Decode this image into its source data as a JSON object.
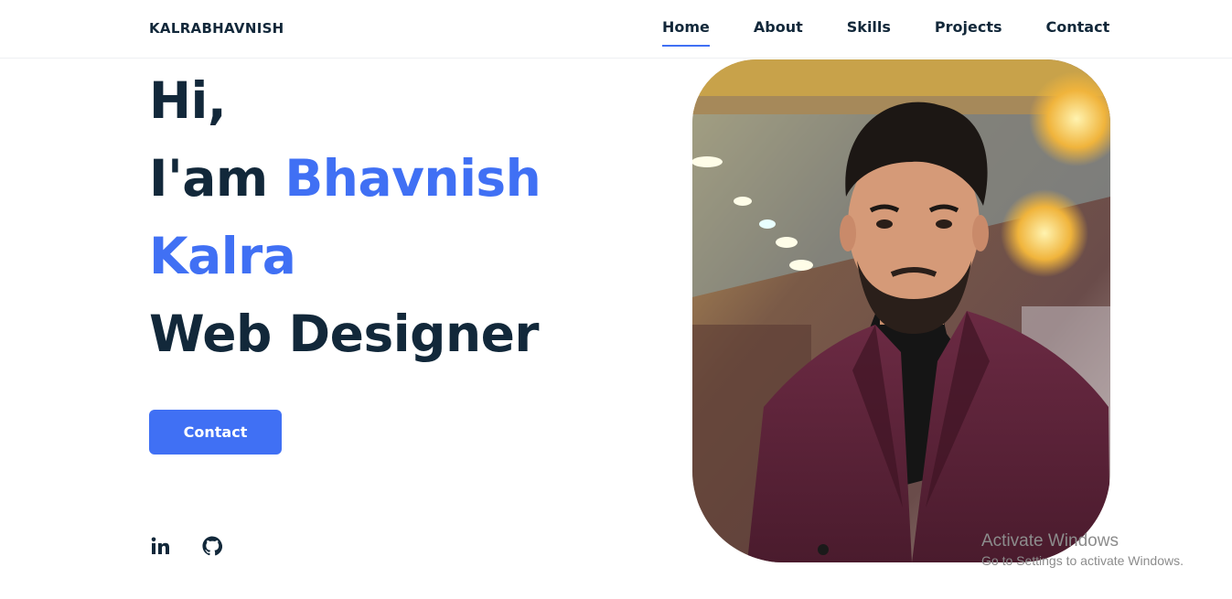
{
  "header": {
    "logo": "KALRABHAVNISH",
    "nav": [
      {
        "label": "Home",
        "active": true
      },
      {
        "label": "About"
      },
      {
        "label": "Skills"
      },
      {
        "label": "Projects"
      },
      {
        "label": "Contact"
      }
    ]
  },
  "hero": {
    "greeting": "Hi,",
    "intro_prefix": "I'am ",
    "first_name": "Bhavnish",
    "last_name": "Kalra",
    "role": "Web Designer",
    "cta_label": "Contact"
  },
  "social": [
    {
      "name": "linkedin",
      "icon": "linkedin-icon"
    },
    {
      "name": "github",
      "icon": "github-icon"
    }
  ],
  "colors": {
    "accent": "#4070f4",
    "text": "#12283a",
    "jacket": "#5b2338"
  },
  "watermark": {
    "title": "Activate Windows",
    "subtitle": "Go to Settings to activate Windows."
  }
}
